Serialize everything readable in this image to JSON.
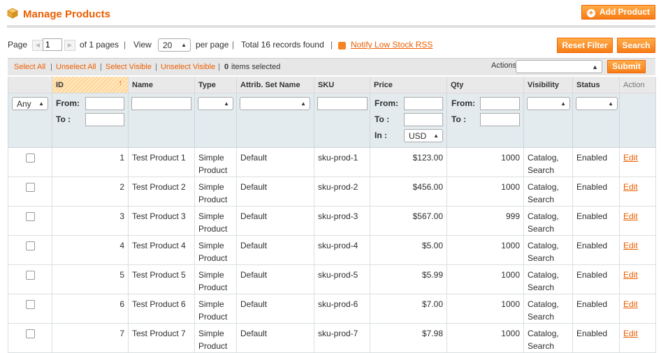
{
  "header": {
    "title": "Manage Products",
    "add_button": "Add Product"
  },
  "pager": {
    "page_label": "Page",
    "page_value": "1",
    "of_pages": "of 1 pages",
    "view_label": "View",
    "per_page_value": "20",
    "per_page_label": "per page",
    "total": "Total 16 records found",
    "rss_link": "Notify Low Stock RSS",
    "reset_filter": "Reset Filter",
    "search": "Search"
  },
  "massaction": {
    "select_all": "Select All",
    "unselect_all": "Unselect All",
    "select_visible": "Select Visible",
    "unselect_visible": "Unselect Visible",
    "count": "0",
    "items_selected": "items selected",
    "actions_label": "Actions",
    "submit": "Submit"
  },
  "columns": [
    "ID",
    "Name",
    "Type",
    "Attrib. Set Name",
    "SKU",
    "Price",
    "Qty",
    "Visibility",
    "Status",
    "Action"
  ],
  "filters": {
    "any": "Any",
    "from": "From:",
    "to": "To :",
    "in": "In :",
    "currency": "USD"
  },
  "rows": [
    {
      "id": "1",
      "name": "Test Product 1",
      "type": "Simple Product",
      "set": "Default",
      "sku": "sku-prod-1",
      "price": "$123.00",
      "qty": "1000",
      "visibility": "Catalog, Search",
      "status": "Enabled",
      "action": "Edit"
    },
    {
      "id": "2",
      "name": "Test Product 2",
      "type": "Simple Product",
      "set": "Default",
      "sku": "sku-prod-2",
      "price": "$456.00",
      "qty": "1000",
      "visibility": "Catalog, Search",
      "status": "Enabled",
      "action": "Edit"
    },
    {
      "id": "3",
      "name": "Test Product 3",
      "type": "Simple Product",
      "set": "Default",
      "sku": "sku-prod-3",
      "price": "$567.00",
      "qty": "999",
      "visibility": "Catalog, Search",
      "status": "Enabled",
      "action": "Edit"
    },
    {
      "id": "4",
      "name": "Test Product 4",
      "type": "Simple Product",
      "set": "Default",
      "sku": "sku-prod-4",
      "price": "$5.00",
      "qty": "1000",
      "visibility": "Catalog, Search",
      "status": "Enabled",
      "action": "Edit"
    },
    {
      "id": "5",
      "name": "Test Product 5",
      "type": "Simple Product",
      "set": "Default",
      "sku": "sku-prod-5",
      "price": "$5.99",
      "qty": "1000",
      "visibility": "Catalog, Search",
      "status": "Enabled",
      "action": "Edit"
    },
    {
      "id": "6",
      "name": "Test Product 6",
      "type": "Simple Product",
      "set": "Default",
      "sku": "sku-prod-6",
      "price": "$7.00",
      "qty": "1000",
      "visibility": "Catalog, Search",
      "status": "Enabled",
      "action": "Edit"
    },
    {
      "id": "7",
      "name": "Test Product 7",
      "type": "Simple Product",
      "set": "Default",
      "sku": "sku-prod-7",
      "price": "$7.98",
      "qty": "1000",
      "visibility": "Catalog, Search",
      "status": "Enabled",
      "action": "Edit"
    }
  ],
  "colors": {
    "accent": "#eb5e00",
    "button": "#f77c16",
    "filter_bg": "#e3ebee"
  }
}
